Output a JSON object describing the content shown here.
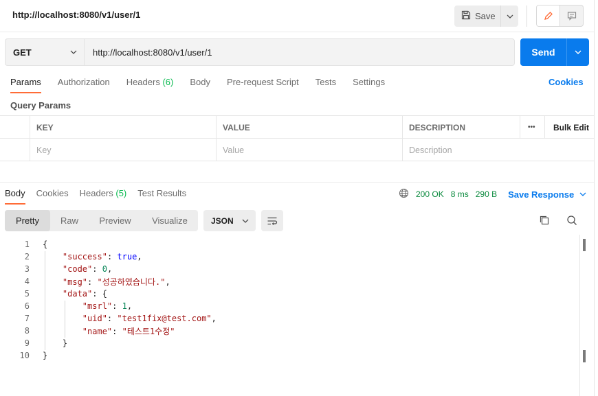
{
  "header": {
    "title": "http://localhost:8080/v1/user/1",
    "save_label": "Save"
  },
  "request": {
    "method": "GET",
    "url": "http://localhost:8080/v1/user/1",
    "send_label": "Send"
  },
  "request_tabs": [
    {
      "label": "Params",
      "count": ""
    },
    {
      "label": "Authorization",
      "count": ""
    },
    {
      "label": "Headers",
      "count": "(6)"
    },
    {
      "label": "Body",
      "count": ""
    },
    {
      "label": "Pre-request Script",
      "count": ""
    },
    {
      "label": "Tests",
      "count": ""
    },
    {
      "label": "Settings",
      "count": ""
    }
  ],
  "cookies_label": "Cookies",
  "query_params": {
    "title": "Query Params",
    "columns": {
      "key": "KEY",
      "value": "VALUE",
      "description": "DESCRIPTION",
      "more": "•••",
      "bulk_edit": "Bulk Edit"
    },
    "placeholders": {
      "key": "Key",
      "value": "Value",
      "description": "Description"
    }
  },
  "response_tabs": [
    {
      "label": "Body",
      "count": ""
    },
    {
      "label": "Cookies",
      "count": ""
    },
    {
      "label": "Headers",
      "count": "(5)"
    },
    {
      "label": "Test Results",
      "count": ""
    }
  ],
  "response_meta": {
    "status": "200 OK",
    "time": "8 ms",
    "size": "290 B",
    "save_response": "Save Response"
  },
  "view_modes": [
    "Pretty",
    "Raw",
    "Preview",
    "Visualize"
  ],
  "format": "JSON",
  "code_lines": [
    {
      "n": "1",
      "t": "{"
    },
    {
      "n": "2",
      "t": "    \"success\": true,"
    },
    {
      "n": "3",
      "t": "    \"code\": 0,"
    },
    {
      "n": "4",
      "t": "    \"msg\": \"성공하였습니다.\","
    },
    {
      "n": "5",
      "t": "    \"data\": {"
    },
    {
      "n": "6",
      "t": "        \"msrl\": 1,"
    },
    {
      "n": "7",
      "t": "        \"uid\": \"test1fix@test.com\","
    },
    {
      "n": "8",
      "t": "        \"name\": \"테스트1수정\""
    },
    {
      "n": "9",
      "t": "    }"
    },
    {
      "n": "10",
      "t": "}"
    }
  ],
  "colors": {
    "accent": "#ff6c37",
    "send": "#097bed",
    "status_green": "#0b8a3e"
  }
}
